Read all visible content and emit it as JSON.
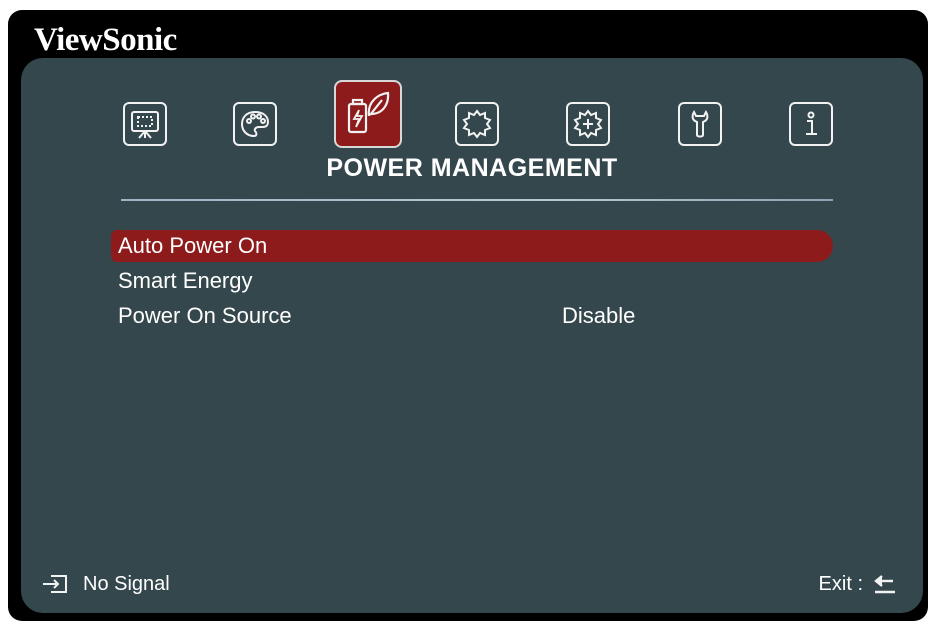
{
  "brand": "ViewSonic",
  "menu": {
    "icons": [
      {
        "name": "display-icon"
      },
      {
        "name": "image-palette-icon"
      },
      {
        "name": "power-management-icon"
      },
      {
        "name": "basic-gear-icon"
      },
      {
        "name": "advanced-gear-icon"
      },
      {
        "name": "tools-icon"
      },
      {
        "name": "information-icon"
      }
    ],
    "active_index": 2,
    "section_title": "POWER MANAGEMENT"
  },
  "rows": [
    {
      "label": "Auto Power On",
      "value": "",
      "selected": true
    },
    {
      "label": "Smart Energy",
      "value": "",
      "selected": false
    },
    {
      "label": "Power On Source",
      "value": "Disable",
      "selected": false
    }
  ],
  "footer": {
    "source_status": "No Signal",
    "exit_label": "Exit :"
  },
  "colors": {
    "panel": "#34474d",
    "accent": "#8d1b1c",
    "text": "#ffffff",
    "frame": "#000000"
  }
}
